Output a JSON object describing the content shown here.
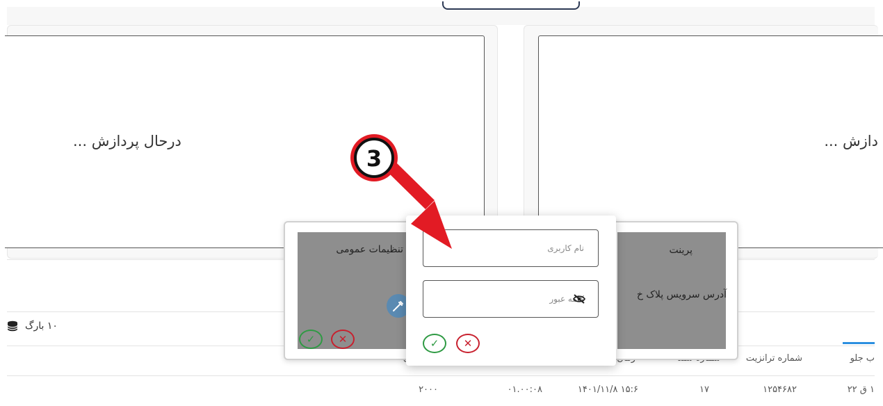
{
  "panels": {
    "left_processing": "درحال پردازش ...",
    "right_processing": "دازش ..."
  },
  "reload": {
    "label": "۱۰ بارگ"
  },
  "table": {
    "headers": [
      "ب جلو",
      "شماره ترانزیت",
      "شماره سند",
      "زمان",
      "ی"
    ],
    "row": [
      "۱ ق ۲۲",
      "۱۲۵۴۶۸۲",
      "۱۷",
      "۱۵:۶ ۱۴۰۱/۱۱/۸",
      "۰۱.۰۰:۰۸",
      "۲۰۰۰"
    ]
  },
  "settings_dialog": {
    "general_settings": "تنظیمات عمومی",
    "print": "پرینت",
    "service_address": "آدرس سرویس پلاک خ"
  },
  "login": {
    "username_placeholder": "نام کاربری",
    "password_placeholder": "کلمه عبور"
  },
  "annotation": {
    "step_number": "3"
  },
  "colors": {
    "accent_blue": "#2d8fe0",
    "ok_green": "#2e9a43",
    "cancel_red": "#c8202e",
    "arrow_red": "#e21b24",
    "overlay_gray": "#8e8e8e"
  },
  "icons": {
    "database": "database-icon",
    "eye_off": "eye-off-icon",
    "plug": "plug-icon",
    "check": "check-icon",
    "close": "close-icon"
  }
}
